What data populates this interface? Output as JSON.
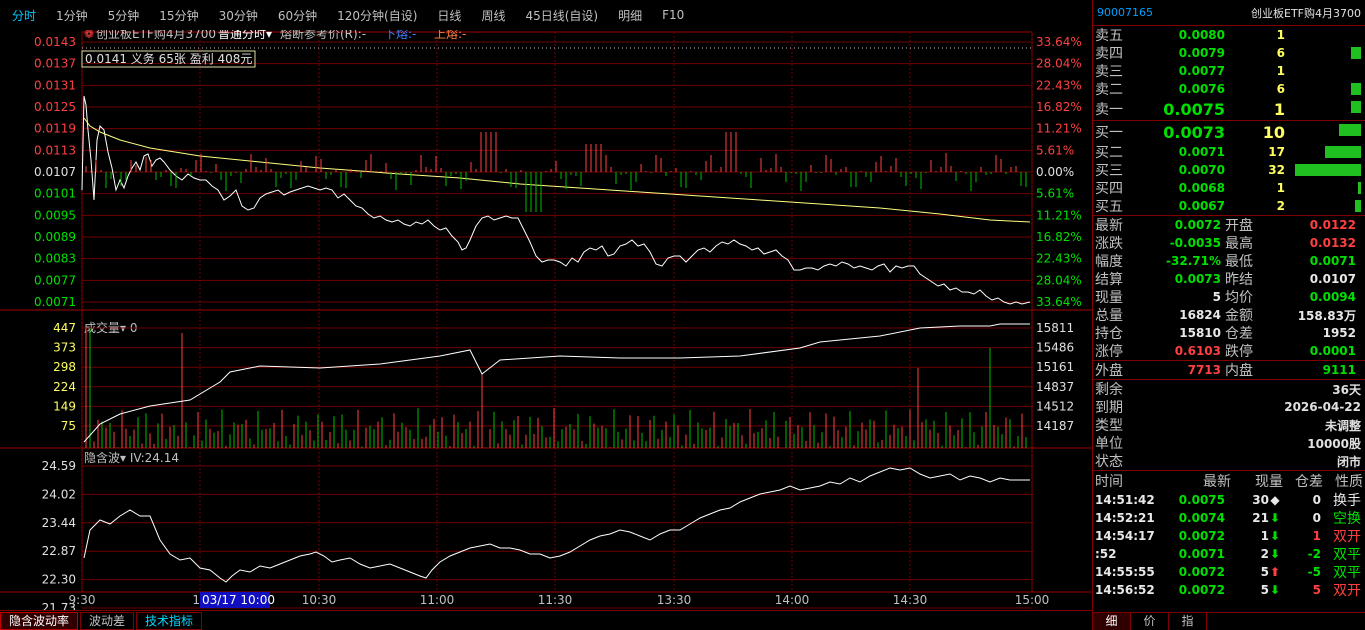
{
  "toolbar": {
    "tabs": [
      "分时",
      "1分钟",
      "5分钟",
      "15分钟",
      "30分钟",
      "60分钟",
      "120分钟(自设)",
      "日线",
      "周线",
      "45日线(自设)",
      "明细",
      "F10"
    ]
  },
  "price_panel": {
    "title": "创业板ETF购4月3700",
    "mode": "普通分时",
    "meltdown_label": "熔断参考价(R):-",
    "lower_label": "下熔:-",
    "upper_label": "上熔:-",
    "info_box": "0.0141 义务 65张 盈利 408元",
    "price_ticks": [
      "0.0143",
      "0.0137",
      "0.0131",
      "0.0125",
      "0.0119",
      "0.0113",
      "0.0107",
      "0.0101",
      "0.0095",
      "0.0089",
      "0.0083",
      "0.0077",
      "0.0071"
    ],
    "pct_ticks": [
      "33.64%",
      "28.04%",
      "22.43%",
      "16.82%",
      "11.21%",
      "5.61%",
      "0.00%",
      "5.61%",
      "11.21%",
      "16.82%",
      "22.43%",
      "28.04%",
      "33.64%"
    ]
  },
  "volume_panel": {
    "title": "成交量",
    "value": "0",
    "left_ticks": [
      "447",
      "373",
      "298",
      "224",
      "149",
      "75"
    ],
    "right_ticks": [
      "15811",
      "15486",
      "15161",
      "14837",
      "14512",
      "14187"
    ]
  },
  "iv_panel": {
    "title": "隐含波",
    "value": "IV:24.14",
    "ticks": [
      "24.59",
      "24.02",
      "23.44",
      "22.87",
      "22.30",
      "21.73"
    ]
  },
  "time_axis": {
    "labels": [
      "9:30",
      "10",
      "10:30",
      "11:00",
      "11:30",
      "13:30",
      "14:00",
      "14:30",
      "15:00"
    ],
    "cursor_label": "03/17 10:00"
  },
  "bottom_tabs": [
    "隐含波动率",
    "波动差",
    "技术指标"
  ],
  "right_panel": {
    "code": "90007165",
    "name": "创业板ETF购4月3700",
    "asks": [
      {
        "label": "卖五",
        "price": "0.0080",
        "vol": "1"
      },
      {
        "label": "卖四",
        "price": "0.0079",
        "vol": "6"
      },
      {
        "label": "卖三",
        "price": "0.0077",
        "vol": "1"
      },
      {
        "label": "卖二",
        "price": "0.0076",
        "vol": "6"
      },
      {
        "label": "卖一",
        "price": "0.0075",
        "vol": "1"
      }
    ],
    "bids": [
      {
        "label": "买一",
        "price": "0.0073",
        "vol": "10"
      },
      {
        "label": "买二",
        "price": "0.0071",
        "vol": "17"
      },
      {
        "label": "买三",
        "price": "0.0070",
        "vol": "32"
      },
      {
        "label": "买四",
        "price": "0.0068",
        "vol": "1"
      },
      {
        "label": "买五",
        "price": "0.0067",
        "vol": "2"
      }
    ],
    "quote": [
      {
        "k": "最新",
        "v": "0.0072",
        "k2": "开盘",
        "v2": "0.0122"
      },
      {
        "k": "涨跌",
        "v": "-0.0035",
        "k2": "最高",
        "v2": "0.0132"
      },
      {
        "k": "幅度",
        "v": "-32.71%",
        "k2": "最低",
        "v2": "0.0071"
      },
      {
        "k": "结算",
        "v": "0.0073",
        "k2": "昨结",
        "v2": "0.0107"
      },
      {
        "k": "现量",
        "v": "5",
        "k2": "均价",
        "v2": "0.0094"
      },
      {
        "k": "总量",
        "v": "16824",
        "k2": "金额",
        "v2": "158.83万"
      },
      {
        "k": "持仓",
        "v": "15810",
        "k2": "仓差",
        "v2": "1952"
      },
      {
        "k": "涨停",
        "v": "0.6103",
        "k2": "跌停",
        "v2": "0.0001"
      }
    ],
    "outer": {
      "k": "外盘",
      "v": "7713",
      "k2": "内盘",
      "v2": "9111"
    },
    "info": [
      {
        "k": "剩余",
        "v": "36天"
      },
      {
        "k": "到期",
        "v": "2026-04-22"
      },
      {
        "k": "类型",
        "v": "未调整"
      },
      {
        "k": "单位",
        "v": "10000股"
      },
      {
        "k": "状态",
        "v": "闭市"
      }
    ],
    "ticks_header": [
      "时间",
      "最新",
      "现量",
      "仓差",
      "性质"
    ],
    "ticks": [
      {
        "time": "14:51:42",
        "price": "0.0075",
        "vol": "30",
        "arrow": "◆",
        "oi": "0",
        "nature": "换手"
      },
      {
        "time": "14:52:21",
        "price": "0.0074",
        "vol": "21",
        "arrow": "⬇",
        "oi": "0",
        "nature": "空换"
      },
      {
        "time": "14:54:17",
        "price": "0.0072",
        "vol": "1",
        "arrow": "⬇",
        "oi": "1",
        "nature": "双开"
      },
      {
        "time": ":52",
        "price": "0.0071",
        "vol": "2",
        "arrow": "⬇",
        "oi": "-2",
        "nature": "双平"
      },
      {
        "time": "14:55:55",
        "price": "0.0072",
        "vol": "5",
        "arrow": "⬆",
        "oi": "-5",
        "nature": "双平"
      },
      {
        "time": "14:56:52",
        "price": "0.0072",
        "vol": "5",
        "arrow": "⬇",
        "oi": "5",
        "nature": "双开"
      }
    ],
    "bottom_tabs": [
      "细",
      "价",
      "指"
    ]
  }
}
